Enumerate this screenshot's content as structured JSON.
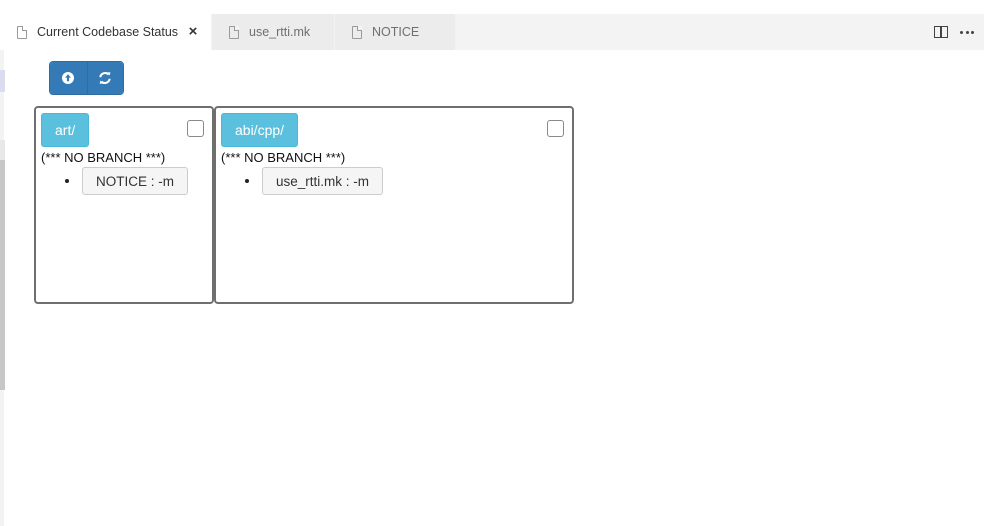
{
  "tabs": [
    {
      "label": "Current Codebase Status",
      "active": true,
      "close": "×"
    },
    {
      "label": "use_rtti.mk",
      "active": false
    },
    {
      "label": "NOTICE",
      "active": false
    }
  ],
  "toolbar": {
    "buttons": [
      {
        "icon": "upload-circle-icon"
      },
      {
        "icon": "refresh-icon"
      }
    ]
  },
  "repos": [
    {
      "path": "art/",
      "branch": "(*** NO BRANCH ***)",
      "files": [
        {
          "label": "NOTICE : -m"
        }
      ]
    },
    {
      "path": "abi/cpp/",
      "branch": "(*** NO BRANCH ***)",
      "files": [
        {
          "label": "use_rtti.mk : -m"
        }
      ]
    }
  ],
  "colors": {
    "primary": "#337ab7",
    "info": "#5bc0de",
    "tab_inactive": "#ececec"
  }
}
